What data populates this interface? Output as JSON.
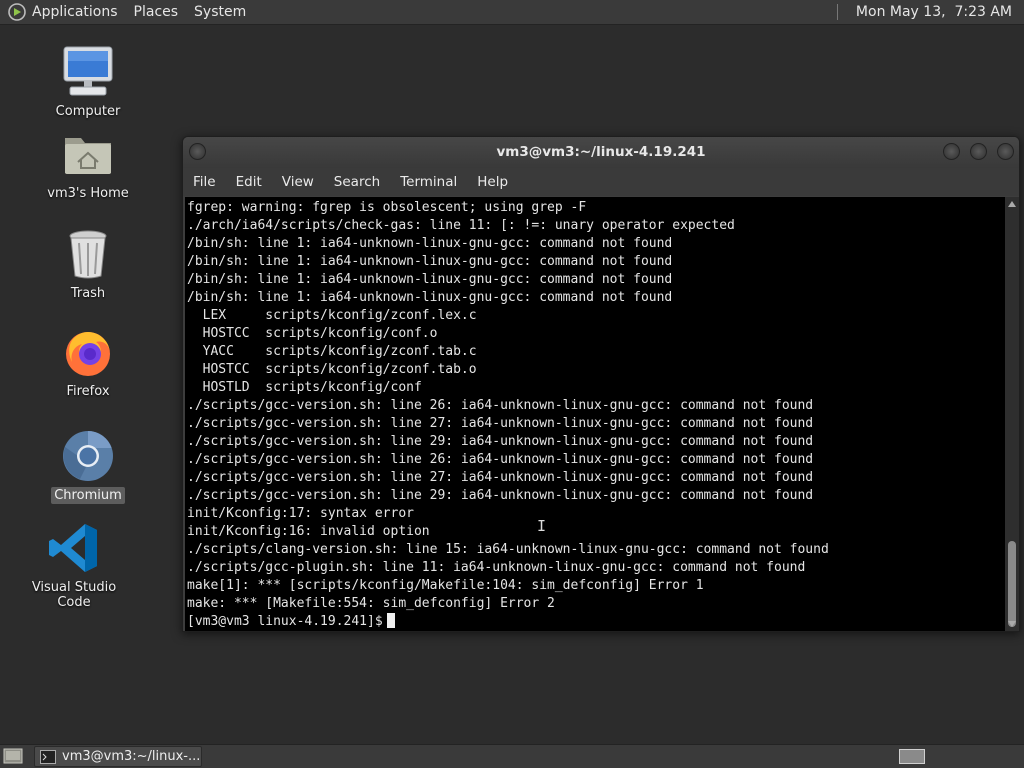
{
  "top_panel": {
    "applications": "Applications",
    "places": "Places",
    "system": "System",
    "clock": "Mon May 13,  7:23 AM"
  },
  "desktop_icons": {
    "computer": "Computer",
    "home": "vm3's Home",
    "trash": "Trash",
    "firefox": "Firefox",
    "chromium": "Chromium",
    "vscode": "Visual Studio Code"
  },
  "terminal": {
    "title": "vm3@vm3:~/linux-4.19.241",
    "menu": [
      "File",
      "Edit",
      "View",
      "Search",
      "Terminal",
      "Help"
    ],
    "lines": [
      "fgrep: warning: fgrep is obsolescent; using grep -F",
      "./arch/ia64/scripts/check-gas: line 11: [: !=: unary operator expected",
      "/bin/sh: line 1: ia64-unknown-linux-gnu-gcc: command not found",
      "/bin/sh: line 1: ia64-unknown-linux-gnu-gcc: command not found",
      "/bin/sh: line 1: ia64-unknown-linux-gnu-gcc: command not found",
      "/bin/sh: line 1: ia64-unknown-linux-gnu-gcc: command not found",
      "  LEX     scripts/kconfig/zconf.lex.c",
      "  HOSTCC  scripts/kconfig/conf.o",
      "  YACC    scripts/kconfig/zconf.tab.c",
      "  HOSTCC  scripts/kconfig/zconf.tab.o",
      "  HOSTLD  scripts/kconfig/conf",
      "./scripts/gcc-version.sh: line 26: ia64-unknown-linux-gnu-gcc: command not found",
      "./scripts/gcc-version.sh: line 27: ia64-unknown-linux-gnu-gcc: command not found",
      "./scripts/gcc-version.sh: line 29: ia64-unknown-linux-gnu-gcc: command not found",
      "./scripts/gcc-version.sh: line 26: ia64-unknown-linux-gnu-gcc: command not found",
      "./scripts/gcc-version.sh: line 27: ia64-unknown-linux-gnu-gcc: command not found",
      "./scripts/gcc-version.sh: line 29: ia64-unknown-linux-gnu-gcc: command not found",
      "init/Kconfig:17: syntax error",
      "init/Kconfig:16: invalid option",
      "./scripts/clang-version.sh: line 15: ia64-unknown-linux-gnu-gcc: command not found",
      "./scripts/gcc-plugin.sh: line 11: ia64-unknown-linux-gnu-gcc: command not found",
      "make[1]: *** [scripts/kconfig/Makefile:104: sim_defconfig] Error 1",
      "make: *** [Makefile:554: sim_defconfig] Error 2"
    ],
    "prompt": "[vm3@vm3 linux-4.19.241]$"
  },
  "taskbar": {
    "task_label": "vm3@vm3:~/linux-..."
  },
  "colors": {
    "panel": "#3a3a3a",
    "desktop": "#2c2c2c",
    "terminal_bg": "#000000",
    "terminal_fg": "#e5e5e5"
  }
}
